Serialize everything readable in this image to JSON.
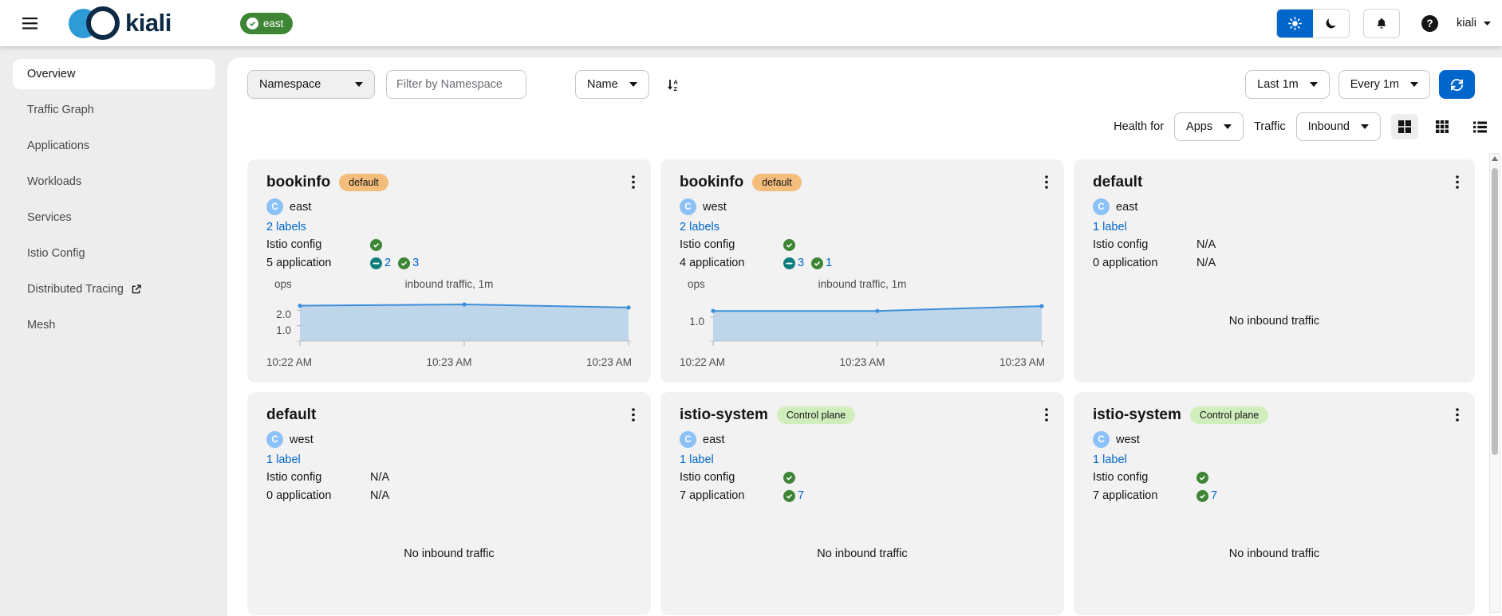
{
  "masthead": {
    "brand": "kiali",
    "cluster_badge": "east",
    "user_menu": "kiali"
  },
  "sidebar": {
    "items": [
      {
        "label": "Overview",
        "active": true,
        "external": false
      },
      {
        "label": "Traffic Graph",
        "active": false,
        "external": false
      },
      {
        "label": "Applications",
        "active": false,
        "external": false
      },
      {
        "label": "Workloads",
        "active": false,
        "external": false
      },
      {
        "label": "Services",
        "active": false,
        "external": false
      },
      {
        "label": "Istio Config",
        "active": false,
        "external": false
      },
      {
        "label": "Distributed Tracing",
        "active": false,
        "external": true
      },
      {
        "label": "Mesh",
        "active": false,
        "external": false
      }
    ]
  },
  "toolbar": {
    "namespace_toggle": "Namespace",
    "filter_placeholder": "Filter by Namespace",
    "sort_toggle": "Name",
    "duration_toggle": "Last 1m",
    "refresh_toggle": "Every 1m",
    "health_for_label": "Health for",
    "health_for_toggle": "Apps",
    "traffic_label": "Traffic",
    "traffic_toggle": "Inbound"
  },
  "strings": {
    "istio_config_label": "Istio config",
    "na": "N/A"
  },
  "colors": {
    "accent_blue": "#0066cc",
    "healthy_green": "#3e8635",
    "idle_teal": "#0e7d7d",
    "chart_line": "#3e8fd9",
    "chart_fill": "rgba(62,143,217,0.28)",
    "badge_default_bg": "#f4bd7c",
    "badge_control_plane_bg": "#d0eebc",
    "cluster_icon_bg": "#8bc1f7",
    "masthead_badge_bg": "#3e8635"
  },
  "cards": [
    {
      "name": "bookinfo",
      "badge": {
        "text": "default",
        "type": "default"
      },
      "cluster": "east",
      "labels_link": "2 labels",
      "istio_config": {
        "statuses": [
          {
            "type": "ok"
          }
        ],
        "text": ""
      },
      "application": {
        "label": "5 application",
        "statuses": [
          {
            "type": "idle",
            "count": "2"
          },
          {
            "type": "ok",
            "count": "3"
          }
        ],
        "text": ""
      },
      "chart": {
        "type": "area",
        "unit": "ops",
        "title": "inbound traffic, 1m",
        "y_ticks": [
          2.0,
          1.0
        ],
        "y_max": 2.9,
        "x_labels": [
          "10:22 AM",
          "10:23 AM",
          "10:23 AM"
        ],
        "points": [
          [
            0,
            2.3
          ],
          [
            0.5,
            2.38
          ],
          [
            1,
            2.18
          ]
        ]
      }
    },
    {
      "name": "bookinfo",
      "badge": {
        "text": "default",
        "type": "default"
      },
      "cluster": "west",
      "labels_link": "2 labels",
      "istio_config": {
        "statuses": [
          {
            "type": "ok"
          }
        ],
        "text": ""
      },
      "application": {
        "label": "4 application",
        "statuses": [
          {
            "type": "idle",
            "count": "3"
          },
          {
            "type": "ok",
            "count": "1"
          }
        ],
        "text": ""
      },
      "chart": {
        "type": "area",
        "unit": "ops",
        "title": "inbound traffic, 1m",
        "y_ticks": [
          1.0
        ],
        "y_max": 1.85,
        "x_labels": [
          "10:22 AM",
          "10:23 AM",
          "10:23 AM"
        ],
        "points": [
          [
            0,
            1.25
          ],
          [
            0.5,
            1.25
          ],
          [
            1,
            1.45
          ]
        ]
      }
    },
    {
      "name": "default",
      "badge": null,
      "cluster": "east",
      "labels_link": "1 label",
      "istio_config": {
        "statuses": [],
        "text": "N/A"
      },
      "application": {
        "label": "0 application",
        "statuses": [],
        "text": "N/A"
      },
      "no_traffic": "No inbound traffic"
    },
    {
      "name": "default",
      "badge": null,
      "cluster": "west",
      "labels_link": "1 label",
      "istio_config": {
        "statuses": [],
        "text": "N/A"
      },
      "application": {
        "label": "0 application",
        "statuses": [],
        "text": "N/A"
      },
      "no_traffic": "No inbound traffic"
    },
    {
      "name": "istio-system",
      "badge": {
        "text": "Control plane",
        "type": "control-plane"
      },
      "cluster": "east",
      "labels_link": "1 label",
      "istio_config": {
        "statuses": [
          {
            "type": "ok"
          }
        ],
        "text": ""
      },
      "application": {
        "label": "7 application",
        "statuses": [
          {
            "type": "ok",
            "count": "7"
          }
        ],
        "text": ""
      },
      "no_traffic": "No inbound traffic"
    },
    {
      "name": "istio-system",
      "badge": {
        "text": "Control plane",
        "type": "control-plane"
      },
      "cluster": "west",
      "labels_link": "1 label",
      "istio_config": {
        "statuses": [
          {
            "type": "ok"
          }
        ],
        "text": ""
      },
      "application": {
        "label": "7 application",
        "statuses": [
          {
            "type": "ok",
            "count": "7"
          }
        ],
        "text": ""
      },
      "no_traffic": "No inbound traffic"
    }
  ]
}
